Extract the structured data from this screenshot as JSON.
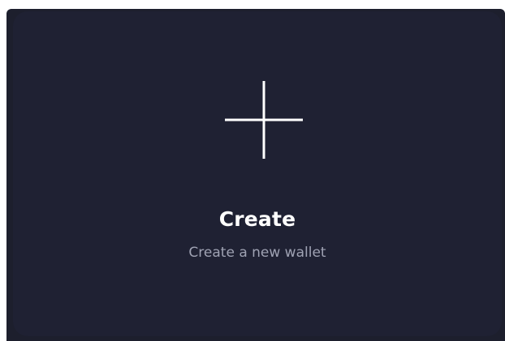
{
  "create_card": {
    "icon": "plus-icon",
    "title": "Create",
    "subtitle": "Create a new wallet"
  },
  "colors": {
    "card_background": "#1f2133",
    "title": "#ffffff",
    "subtitle": "#9fa2b3",
    "icon": "#ffffff"
  }
}
